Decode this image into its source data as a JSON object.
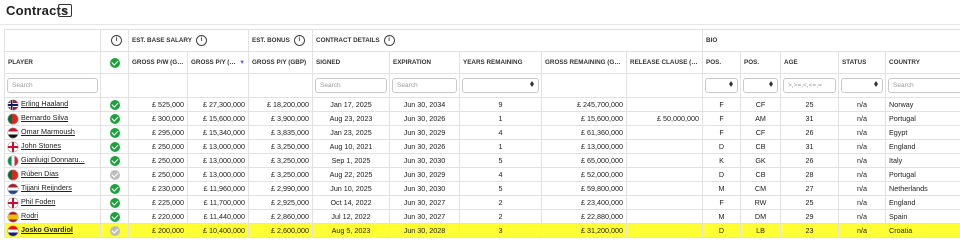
{
  "page": {
    "title": "Contracts",
    "collapse_icon": "chevron-down-icon"
  },
  "groups": {
    "est_base_salary": "EST. BASE SALARY",
    "est_bonus": "EST. BONUS",
    "contract_details": "CONTRACT DETAILS",
    "bio": "BIO"
  },
  "columns": {
    "player": "PLAYER",
    "gross_pw": "GROSS P/W (GBP)",
    "gross_py": "GROSS P/Y (GBP)",
    "bonus_py": "GROSS P/Y (GBP)",
    "signed": "SIGNED",
    "expiration": "EXPIRATION",
    "years_remaining": "YEARS REMAINING",
    "gross_remaining": "GROSS REMAINING (GBP)",
    "release_clause": "RELEASE CLAUSE (GBP)",
    "pos1": "POS.",
    "pos2": "POS.",
    "age": "AGE",
    "status": "STATUS",
    "country": "COUNTRY"
  },
  "filters": {
    "player_placeholder": "Search",
    "signed_placeholder": "Search",
    "expiration_placeholder": "Search",
    "age_placeholder": ">,>=,<,<=,=",
    "country_placeholder": "Search"
  },
  "colors": {
    "highlight": "#ffff33",
    "check_green": "#1aa33b",
    "check_grey": "#bdbdbd",
    "sort_indicator": "#6b5cd6"
  },
  "rows": [
    {
      "player": "Erling Haaland",
      "flag": "norway",
      "check": "green",
      "pw": "£ 525,000",
      "py": "£ 27,300,000",
      "bonus": "£ 18,200,000",
      "signed": "Jan 17, 2025",
      "expiration": "Jun 30, 2034",
      "years": "9",
      "remaining": "£ 245,700,000",
      "release": "",
      "pos1": "F",
      "pos2": "CF",
      "age": "25",
      "status": "n/a",
      "country": "Norway",
      "highlight": false
    },
    {
      "player": "Bernardo Silva",
      "flag": "portugal",
      "check": "green",
      "pw": "£ 300,000",
      "py": "£ 15,600,000",
      "bonus": "£ 3,900,000",
      "signed": "Aug 23, 2023",
      "expiration": "Jun 30, 2026",
      "years": "1",
      "remaining": "£ 15,600,000",
      "release": "£ 50,000,000",
      "pos1": "F",
      "pos2": "AM",
      "age": "31",
      "status": "n/a",
      "country": "Portugal",
      "highlight": false
    },
    {
      "player": "Omar Marmoush",
      "flag": "egypt",
      "check": "green",
      "pw": "£ 295,000",
      "py": "£ 15,340,000",
      "bonus": "£ 3,835,000",
      "signed": "Jan 23, 2025",
      "expiration": "Jun 30, 2029",
      "years": "4",
      "remaining": "£ 61,360,000",
      "release": "",
      "pos1": "F",
      "pos2": "CF",
      "age": "26",
      "status": "n/a",
      "country": "Egypt",
      "highlight": false
    },
    {
      "player": "John Stones",
      "flag": "england",
      "check": "green",
      "pw": "£ 250,000",
      "py": "£ 13,000,000",
      "bonus": "£ 3,250,000",
      "signed": "Aug 10, 2021",
      "expiration": "Jun 30, 2026",
      "years": "1",
      "remaining": "£ 13,000,000",
      "release": "",
      "pos1": "D",
      "pos2": "CB",
      "age": "31",
      "status": "n/a",
      "country": "England",
      "highlight": false
    },
    {
      "player": "Gianluigi Donnaru...",
      "flag": "italy",
      "check": "green",
      "pw": "£ 250,000",
      "py": "£ 13,000,000",
      "bonus": "£ 3,250,000",
      "signed": "Sep 1, 2025",
      "expiration": "Jun 30, 2030",
      "years": "5",
      "remaining": "£ 65,000,000",
      "release": "",
      "pos1": "K",
      "pos2": "GK",
      "age": "26",
      "status": "n/a",
      "country": "Italy",
      "highlight": false
    },
    {
      "player": "Rúben Dias",
      "flag": "portugal",
      "check": "grey",
      "pw": "£ 250,000",
      "py": "£ 13,000,000",
      "bonus": "£ 3,250,000",
      "signed": "Aug 22, 2025",
      "expiration": "Jun 30, 2029",
      "years": "4",
      "remaining": "£ 52,000,000",
      "release": "",
      "pos1": "D",
      "pos2": "CB",
      "age": "28",
      "status": "n/a",
      "country": "Portugal",
      "highlight": false
    },
    {
      "player": "Tijjani Reijnders",
      "flag": "netherlands",
      "check": "green",
      "pw": "£ 230,000",
      "py": "£ 11,960,000",
      "bonus": "£ 2,990,000",
      "signed": "Jun 10, 2025",
      "expiration": "Jun 30, 2030",
      "years": "5",
      "remaining": "£ 59,800,000",
      "release": "",
      "pos1": "M",
      "pos2": "CM",
      "age": "27",
      "status": "n/a",
      "country": "Netherlands",
      "highlight": false
    },
    {
      "player": "Phil Foden",
      "flag": "england",
      "check": "green",
      "pw": "£ 225,000",
      "py": "£ 11,700,000",
      "bonus": "£ 2,925,000",
      "signed": "Oct 14, 2022",
      "expiration": "Jun 30, 2027",
      "years": "2",
      "remaining": "£ 23,400,000",
      "release": "",
      "pos1": "F",
      "pos2": "RW",
      "age": "25",
      "status": "n/a",
      "country": "England",
      "highlight": false
    },
    {
      "player": "Rodri",
      "flag": "spain",
      "check": "green",
      "pw": "£ 220,000",
      "py": "£ 11,440,000",
      "bonus": "£ 2,860,000",
      "signed": "Jul 12, 2022",
      "expiration": "Jun 30, 2027",
      "years": "2",
      "remaining": "£ 22,880,000",
      "release": "",
      "pos1": "M",
      "pos2": "DM",
      "age": "29",
      "status": "n/a",
      "country": "Spain",
      "highlight": false
    },
    {
      "player": "Josko Gvardiol",
      "flag": "croatia",
      "check": "grey",
      "pw": "£ 200,000",
      "py": "£ 10,400,000",
      "bonus": "£ 2,600,000",
      "signed": "Aug 5, 2023",
      "expiration": "Jun 30, 2028",
      "years": "3",
      "remaining": "£ 31,200,000",
      "release": "",
      "pos1": "D",
      "pos2": "LB",
      "age": "23",
      "status": "n/a",
      "country": "Croatia",
      "highlight": true
    }
  ]
}
